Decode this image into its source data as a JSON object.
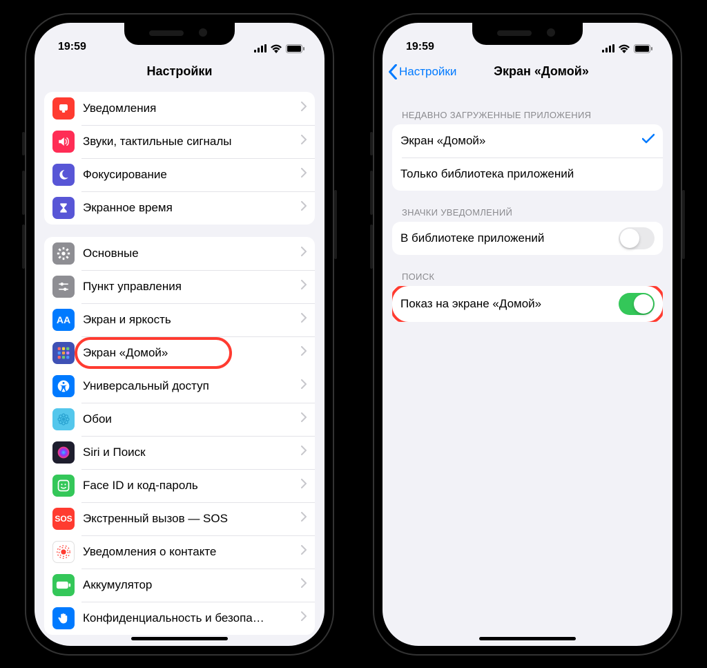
{
  "status": {
    "time": "19:59"
  },
  "phone1": {
    "title": "Настройки",
    "group1": [
      {
        "id": "notifications",
        "label": "Уведомления",
        "color": "#ff3b30",
        "icon": "bell"
      },
      {
        "id": "sounds",
        "label": "Звуки, тактильные сигналы",
        "color": "#ff2d55",
        "icon": "speaker"
      },
      {
        "id": "focus",
        "label": "Фокусирование",
        "color": "#5856d6",
        "icon": "moon"
      },
      {
        "id": "screentime",
        "label": "Экранное время",
        "color": "#5856d6",
        "icon": "hourglass"
      }
    ],
    "group2": [
      {
        "id": "general",
        "label": "Основные",
        "color": "#8e8e93",
        "icon": "gear"
      },
      {
        "id": "controlcenter",
        "label": "Пункт управления",
        "color": "#8e8e93",
        "icon": "sliders"
      },
      {
        "id": "display",
        "label": "Экран и яркость",
        "color": "#007aff",
        "icon": "aa"
      },
      {
        "id": "homescreen",
        "label": "Экран «Домой»",
        "color": "#3f51b5",
        "icon": "grid",
        "highlight": true
      },
      {
        "id": "accessibility",
        "label": "Универсальный доступ",
        "color": "#007aff",
        "icon": "access"
      },
      {
        "id": "wallpaper",
        "label": "Обои",
        "color": "#54c7ec",
        "icon": "flower"
      },
      {
        "id": "siri",
        "label": "Siri и Поиск",
        "color": "#1e1e2e",
        "icon": "siri"
      },
      {
        "id": "faceid",
        "label": "Face ID и код-пароль",
        "color": "#34c759",
        "icon": "face"
      },
      {
        "id": "sos",
        "label": "Экстренный вызов — SOS",
        "color": "#ff3b30",
        "icon": "sos"
      },
      {
        "id": "exposure",
        "label": "Уведомления о контакте",
        "color": "#ffffff",
        "icon": "exposure"
      },
      {
        "id": "battery",
        "label": "Аккумулятор",
        "color": "#34c759",
        "icon": "battery"
      },
      {
        "id": "privacy",
        "label": "Конфиденциальность и безопа…",
        "color": "#007aff",
        "icon": "hand"
      }
    ]
  },
  "phone2": {
    "back": "Настройки",
    "title": "Экран «Домой»",
    "section1_header": "НЕДАВНО ЗАГРУЖЕННЫЕ ПРИЛОЖЕНИЯ",
    "section1": [
      {
        "id": "opt-home",
        "label": "Экран «Домой»",
        "checked": true
      },
      {
        "id": "opt-library",
        "label": "Только библиотека приложений",
        "checked": false
      }
    ],
    "section2_header": "ЗНАЧКИ УВЕДОМЛЕНИЙ",
    "section2": {
      "id": "badges-library",
      "label": "В библиотеке приложений",
      "on": false
    },
    "section3_header": "ПОИСК",
    "section3": {
      "id": "show-search",
      "label": "Показ на экране «Домой»",
      "on": true,
      "highlight": true
    }
  }
}
